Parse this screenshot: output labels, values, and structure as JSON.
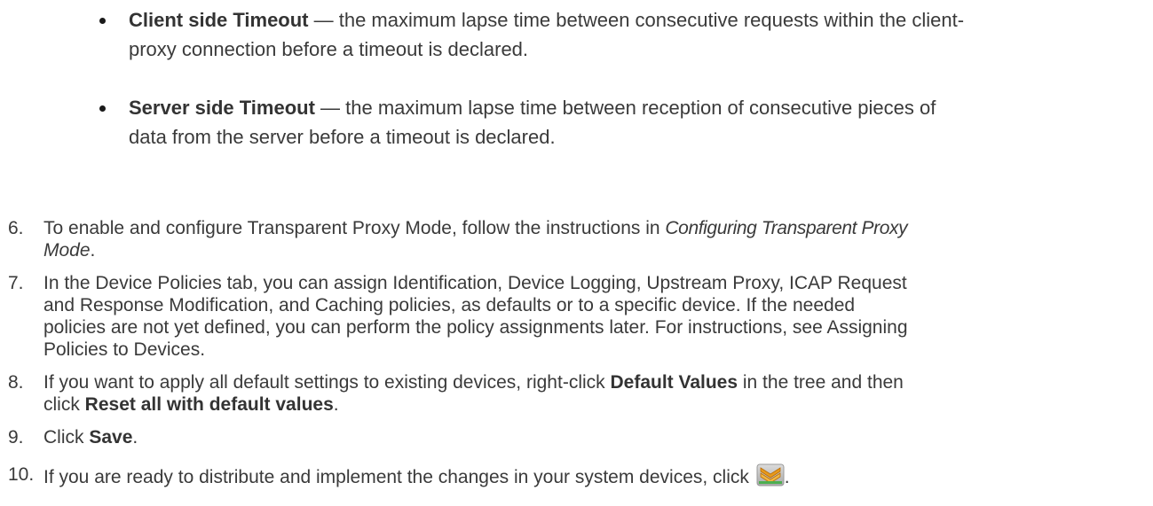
{
  "bullets": [
    {
      "term": "Client side Timeout",
      "line1": " — the maximum lapse time between consecutive requests within the client-",
      "line2": "proxy connection before a timeout is declared."
    },
    {
      "term": "Server side Timeout",
      "line1": " — the maximum lapse time between reception of consecutive pieces of",
      "line2": "data from the server before a timeout is declared."
    }
  ],
  "steps": {
    "s6": {
      "num": "6.",
      "text_a": "To enable and configure Transparent Proxy Mode, follow the instructions in ",
      "ref_a": "Configuring Transparent Proxy",
      "ref_b": "Mode",
      "text_b": "."
    },
    "s7": {
      "num": "7.",
      "line1": "In the Device Policies tab, you can assign Identification, Device Logging, Upstream Proxy, ICAP Request",
      "line2": "and Response Modification, and Caching policies, as defaults or to a specific device. If the needed",
      "line3": "policies are not yet defined, you can perform the policy assignments later. For instructions, see Assigning",
      "line4": "Policies to Devices."
    },
    "s8": {
      "num": "8.",
      "text_a": "If you want to apply all default settings to existing devices, right-click ",
      "bold_a": "Default Values",
      "text_b": " in the tree and then",
      "text_c": "click ",
      "bold_b": "Reset all with default values",
      "text_d": "."
    },
    "s9": {
      "num": "9.",
      "text_a": "Click ",
      "bold_a": "Save",
      "text_b": "."
    },
    "s10": {
      "num": "10.",
      "text_a": "If you are ready to distribute and implement the changes in your system devices, click ",
      "icon": "distribute-icon",
      "text_b": "."
    }
  }
}
